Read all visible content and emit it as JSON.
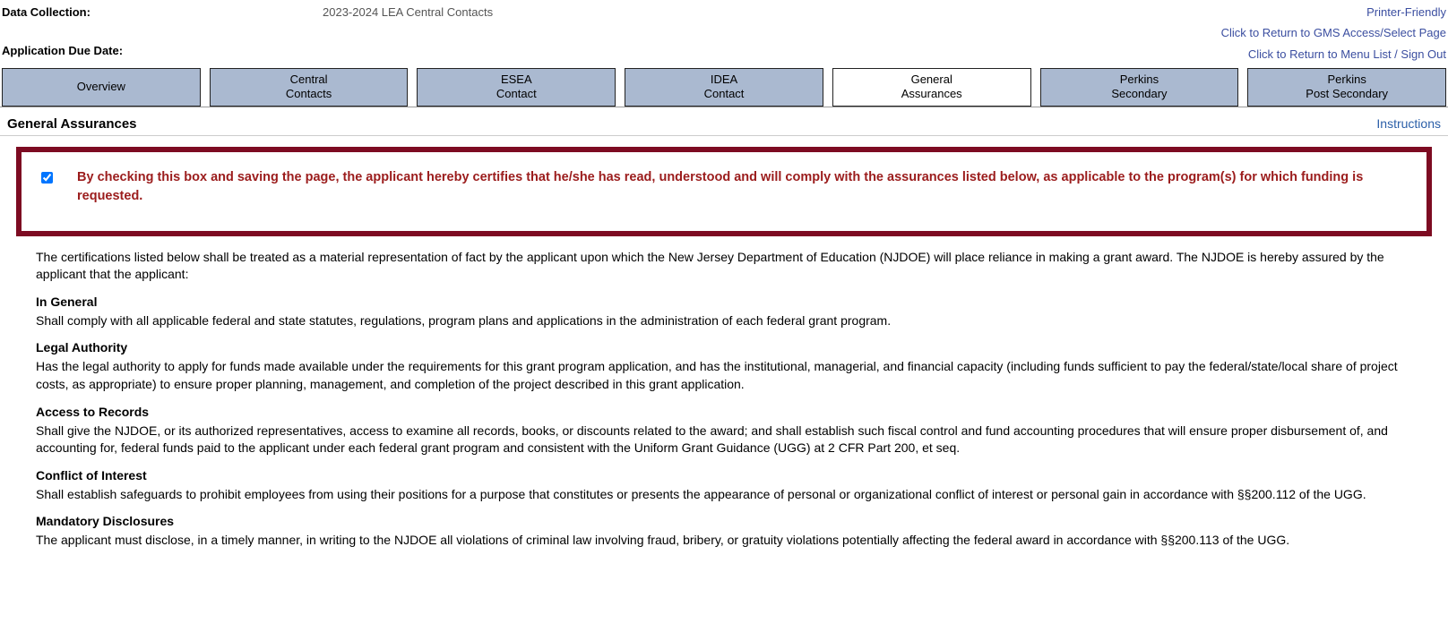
{
  "header": {
    "data_collection_label": "Data Collection:",
    "data_collection_value": "2023-2024 LEA Central Contacts",
    "due_date_label": "Application Due Date:"
  },
  "top_links": {
    "printer": "Printer-Friendly",
    "return_gms": "Click to Return to GMS Access/Select Page",
    "return_menu": "Click to Return to Menu List / Sign Out"
  },
  "tabs": [
    {
      "label": "Overview"
    },
    {
      "label": "Central\nContacts"
    },
    {
      "label": "ESEA\nContact"
    },
    {
      "label": "IDEA\nContact"
    },
    {
      "label": "General\nAssurances"
    },
    {
      "label": "Perkins\nSecondary"
    },
    {
      "label": "Perkins\nPost Secondary"
    }
  ],
  "section": {
    "title": "General Assurances",
    "instructions": "Instructions"
  },
  "callout": {
    "text": "By checking this box and saving the page, the applicant hereby certifies that he/she has read, understood and will comply with the assurances listed below, as applicable to the program(s) for which funding is requested."
  },
  "content": {
    "intro": "The certifications listed below shall be treated as a material representation of fact by the applicant upon which the New Jersey Department of Education (NJDOE) will place reliance in making a grant award. The NJDOE is hereby assured by the applicant that the applicant:",
    "sections": [
      {
        "heading": "In General",
        "text": "Shall comply with all applicable federal and state statutes, regulations, program plans and applications in the administration of each federal grant program."
      },
      {
        "heading": "Legal Authority",
        "text": "Has the legal authority to apply for funds made available under the requirements for this grant program application, and has the institutional, managerial, and financial capacity (including funds sufficient to pay the federal/state/local share of project costs, as appropriate) to ensure proper planning, management, and completion of the project described in this grant application."
      },
      {
        "heading": "Access to Records",
        "text": "Shall give the NJDOE, or its authorized representatives, access to examine all records, books, or discounts related to the award; and shall establish such fiscal control and fund accounting procedures that will ensure proper disbursement of, and accounting for, federal funds paid to the applicant under each federal grant program and consistent with the Uniform Grant Guidance (UGG) at 2 CFR Part 200, et seq."
      },
      {
        "heading": "Conflict of Interest",
        "text": "Shall establish safeguards to prohibit employees from using their positions for a purpose that constitutes or presents the appearance of personal or organizational conflict of interest or personal gain in accordance with §§200.112 of the UGG."
      },
      {
        "heading": "Mandatory Disclosures",
        "text": "The applicant must disclose, in a timely manner, in writing to the NJDOE all violations of criminal law involving fraud, bribery, or gratuity violations potentially affecting the federal award in accordance with §§200.113 of the UGG."
      }
    ]
  }
}
